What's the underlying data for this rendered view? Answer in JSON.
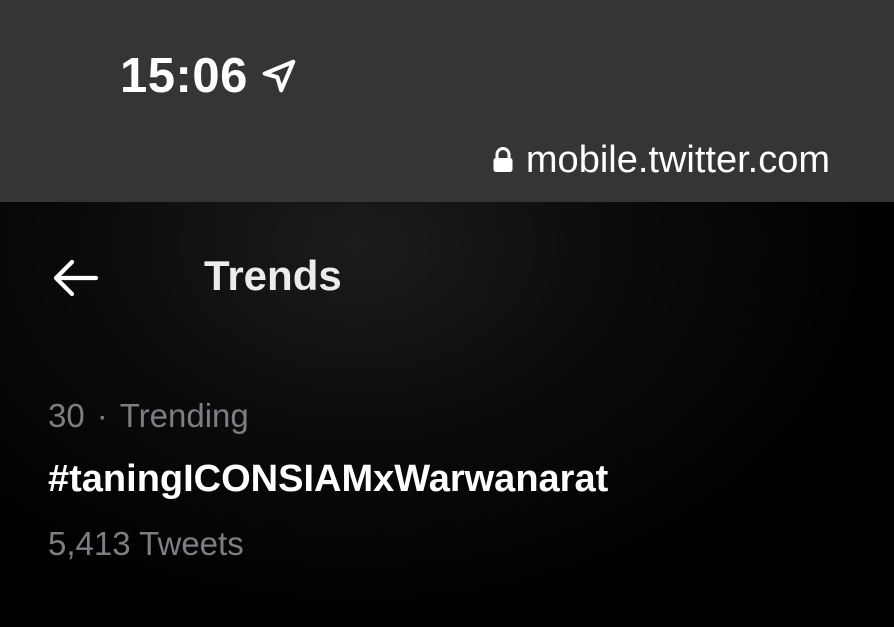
{
  "status_bar": {
    "time": "15:06",
    "location_icon": "location-arrow-icon",
    "lock_icon": "lock-icon",
    "url": "mobile.twitter.com"
  },
  "header": {
    "back_icon": "arrow-left-icon",
    "title": "Trends"
  },
  "trends": [
    {
      "rank": "30",
      "separator": "·",
      "category": "Trending",
      "name": "#taningICONSIAMxWarwanarat",
      "count": "5,413 Tweets"
    }
  ],
  "colors": {
    "status_bar_bg": "#353538",
    "page_bg": "#000000",
    "primary_text": "#ffffff",
    "secondary_text": "#7b7f84"
  }
}
